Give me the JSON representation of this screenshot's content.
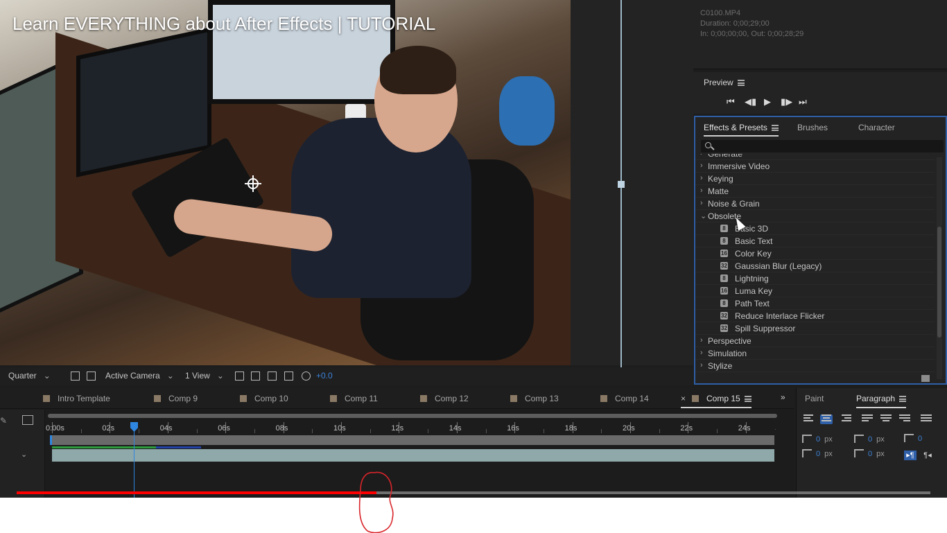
{
  "video": {
    "title": "Learn EVERYTHING about After Effects | TUTORIAL",
    "info_icon": "info-icon",
    "clock_icon": "watch-later-icon",
    "progress_percent": 39.4
  },
  "project_info": {
    "filename": "C0100.MP4",
    "duration": "Duration: 0;00;29;00",
    "in_out": "In: 0;00;00;00, Out: 0;00;28;29"
  },
  "preview": {
    "title": "Preview",
    "controls": [
      "first-frame-icon",
      "prev-frame-icon",
      "play-icon",
      "next-frame-icon",
      "last-frame-icon"
    ]
  },
  "effects_panel": {
    "tabs": [
      {
        "label": "Effects & Presets",
        "active": true
      },
      {
        "label": "Brushes",
        "active": false
      },
      {
        "label": "Character",
        "active": false
      }
    ],
    "search_placeholder": "",
    "items": [
      {
        "label": "Generate",
        "type": "category",
        "expanded": false
      },
      {
        "label": "Immersive Video",
        "type": "category",
        "expanded": false
      },
      {
        "label": "Keying",
        "type": "category",
        "expanded": false
      },
      {
        "label": "Matte",
        "type": "category",
        "expanded": false
      },
      {
        "label": "Noise & Grain",
        "type": "category",
        "expanded": false
      },
      {
        "label": "Obsolete",
        "type": "category",
        "expanded": true
      },
      {
        "label": "Basic 3D",
        "type": "effect",
        "badge": "8"
      },
      {
        "label": "Basic Text",
        "type": "effect",
        "badge": "8"
      },
      {
        "label": "Color Key",
        "type": "effect",
        "badge": "16"
      },
      {
        "label": "Gaussian Blur (Legacy)",
        "type": "effect",
        "badge": "32"
      },
      {
        "label": "Lightning",
        "type": "effect",
        "badge": "8"
      },
      {
        "label": "Luma Key",
        "type": "effect",
        "badge": "16"
      },
      {
        "label": "Path Text",
        "type": "effect",
        "badge": "8"
      },
      {
        "label": "Reduce Interlace Flicker",
        "type": "effect",
        "badge": "32"
      },
      {
        "label": "Spill Suppressor",
        "type": "effect",
        "badge": "32"
      },
      {
        "label": "Perspective",
        "type": "category",
        "expanded": false
      },
      {
        "label": "Simulation",
        "type": "category",
        "expanded": false
      },
      {
        "label": "Stylize",
        "type": "category",
        "expanded": false
      }
    ]
  },
  "viewer_toolbar": {
    "resolution": "Quarter",
    "camera": "Active Camera",
    "views": "1 View",
    "exposure": "+0.0"
  },
  "comp_tabs": [
    {
      "label": "Intro Template",
      "active": false
    },
    {
      "label": "Comp 9",
      "active": false
    },
    {
      "label": "Comp 10",
      "active": false
    },
    {
      "label": "Comp 11",
      "active": false
    },
    {
      "label": "Comp 12",
      "active": false
    },
    {
      "label": "Comp 13",
      "active": false
    },
    {
      "label": "Comp 14",
      "active": false
    },
    {
      "label": "Comp 15",
      "active": true
    }
  ],
  "timeline": {
    "ruler_labels": [
      "0:00s",
      "02s",
      "04s",
      "06s",
      "08s",
      "10s",
      "12s",
      "14s",
      "16s",
      "18s",
      "20s",
      "22s",
      "24s"
    ],
    "current_time_seconds": 2.8
  },
  "paragraph_panel": {
    "tabs": [
      {
        "label": "Paint",
        "active": false
      },
      {
        "label": "Paragraph",
        "active": true
      }
    ],
    "fields": [
      {
        "value": "0",
        "unit": "px"
      },
      {
        "value": "0",
        "unit": "px"
      },
      {
        "value": "0",
        "unit": "px"
      },
      {
        "value": "0",
        "unit": "px"
      },
      {
        "value": "0",
        "unit": "px"
      }
    ]
  },
  "colors": {
    "accent_blue": "#2f86e0",
    "youtube_red": "#ff0000",
    "panel_bg": "#232323",
    "annotation_red": "#d9252a"
  }
}
